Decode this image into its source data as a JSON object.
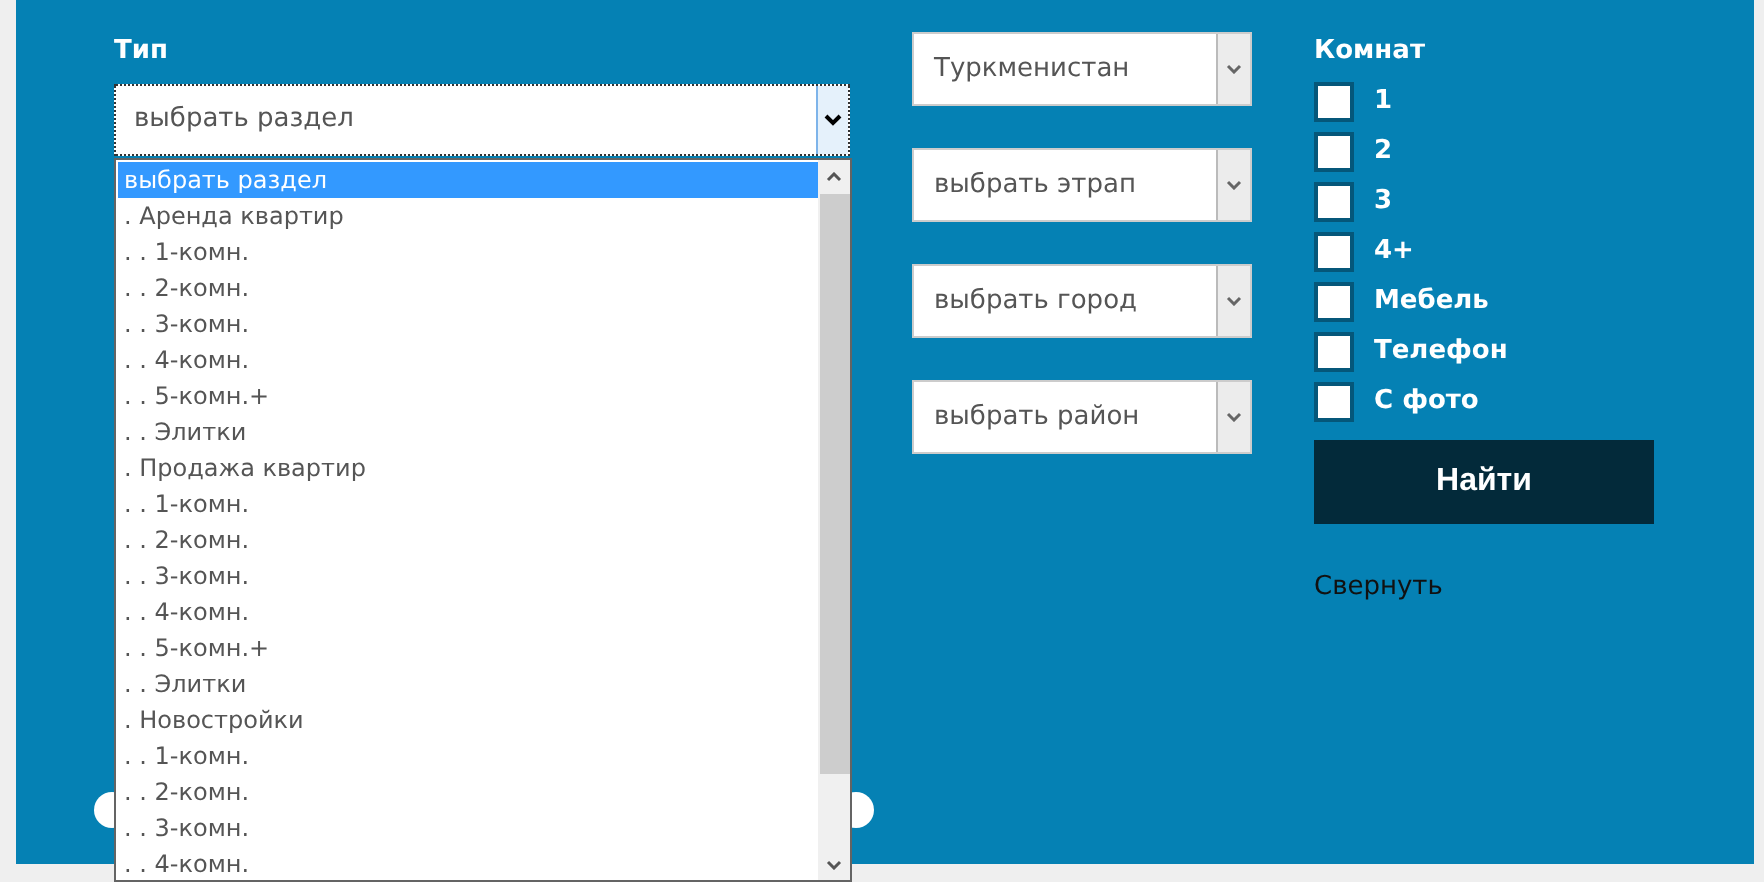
{
  "type_filter": {
    "label": "Тип",
    "value": "выбрать раздел",
    "options": [
      {
        "label": "выбрать раздел",
        "selected": true
      },
      {
        "label": ". Аренда квартир",
        "selected": false
      },
      {
        "label": ". . 1-комн.",
        "selected": false
      },
      {
        "label": ". . 2-комн.",
        "selected": false
      },
      {
        "label": ". . 3-комн.",
        "selected": false
      },
      {
        "label": ". . 4-комн.",
        "selected": false
      },
      {
        "label": ". . 5-комн.+",
        "selected": false
      },
      {
        "label": ". . Элитки",
        "selected": false
      },
      {
        "label": ". Продажа квартир",
        "selected": false
      },
      {
        "label": ". . 1-комн.",
        "selected": false
      },
      {
        "label": ". . 2-комн.",
        "selected": false
      },
      {
        "label": ". . 3-комн.",
        "selected": false
      },
      {
        "label": ". . 4-комн.",
        "selected": false
      },
      {
        "label": ". . 5-комн.+",
        "selected": false
      },
      {
        "label": ". . Элитки",
        "selected": false
      },
      {
        "label": ". Новостройки",
        "selected": false
      },
      {
        "label": ". . 1-комн.",
        "selected": false
      },
      {
        "label": ". . 2-комн.",
        "selected": false
      },
      {
        "label": ". . 3-комн.",
        "selected": false
      },
      {
        "label": ". . 4-комн.",
        "selected": false
      }
    ]
  },
  "location_selects": [
    {
      "value": "Туркменистан"
    },
    {
      "value": "выбрать этрап"
    },
    {
      "value": "выбрать город"
    },
    {
      "value": "выбрать район"
    }
  ],
  "rooms": {
    "label": "Комнат",
    "options": [
      {
        "label": "1",
        "checked": false
      },
      {
        "label": "2",
        "checked": false
      },
      {
        "label": "3",
        "checked": false
      },
      {
        "label": "4+",
        "checked": false
      },
      {
        "label": "Мебель",
        "checked": false
      },
      {
        "label": "Телефон",
        "checked": false
      },
      {
        "label": "С фото",
        "checked": false
      }
    ]
  },
  "search_button": "Найти",
  "collapse_link": "Свернуть"
}
